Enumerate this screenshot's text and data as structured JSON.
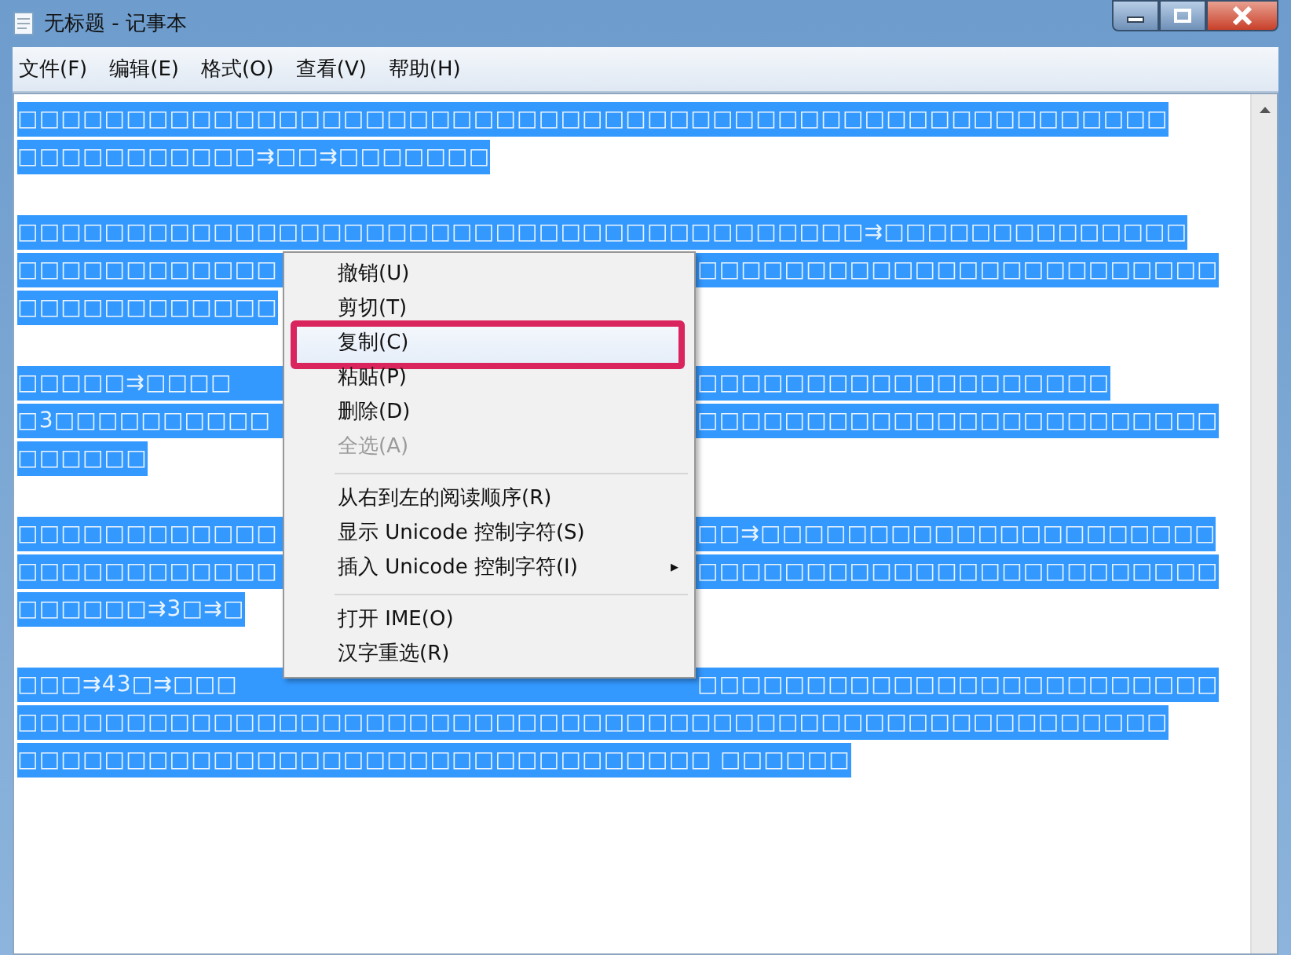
{
  "window": {
    "title": "无标题 - 记事本"
  },
  "menu_bar": [
    "文件(F)",
    "编辑(E)",
    "格式(O)",
    "查看(V)",
    "帮助(H)"
  ],
  "paragraphs": [
    {
      "lines": [
        {
          "left": "□□□□□□□□□□□□□□□□□□□□□□□□□□□□□□□□□□□□□□□□□□□□□□□□□□□□□"
        },
        {
          "left": "□□□□□□□□□□□⇉□□⇉□□□□□□□"
        }
      ]
    },
    {
      "lines": [
        {
          "left": "□□□□□□□□□□□□□□□□□□□□□□□□□□□□□□□□□□□□□□□⇉□□□□□□□□□□□□□□"
        },
        {
          "left": "□□□□□□□□□□□□",
          "right": "□□□□□□□□□□□□□□□□□□□□□□□□"
        },
        {
          "left": "□□□□□□□□□□□□"
        }
      ]
    },
    {
      "lines": [
        {
          "left": "□□□□□⇉□□□□",
          "right": "□□□□□□□□□□□□□□□□□□□"
        },
        {
          "left": "□3□□□□□□□□□□",
          "right": "□□□□□□□□□□□□□□□□□□□□□□□□"
        },
        {
          "left": "□□□□□□"
        }
      ]
    },
    {
      "lines": [
        {
          "left": "□□□□□□□□□□□□",
          "right": "□□⇉□□□□□□□□□□□□□□□□□□□□□"
        },
        {
          "left": "□□□□□□□□□□□□",
          "right": "□□□□□□□□□□□□□□□□□□□□□□□□"
        },
        {
          "left": "□□□□□□⇉3□⇉□"
        }
      ]
    },
    {
      "lines": [
        {
          "left": "□□□⇉43□⇉□□□",
          "right": "□□□□□□□□□□□□□□□□□□□□□□□□"
        },
        {
          "left": "□□□□□□□□□□□□□□□□□□□□□□□□□□□□□□□□□□□□□□□□□□□□□□□□□□□□□"
        },
        {
          "left": "□□□□□□□□□□□□□□□□□□□□□□□□□□□□□□□□ □□□□□□"
        }
      ]
    }
  ],
  "context_menu": {
    "items": [
      {
        "kind": "item",
        "label": "撤销(U)",
        "disabled": false,
        "selected": false,
        "highlighted": false
      },
      {
        "kind": "item",
        "label": "剪切(T)",
        "disabled": false,
        "selected": false,
        "highlighted": false
      },
      {
        "kind": "item",
        "label": "复制(C)",
        "disabled": false,
        "selected": true,
        "highlighted": true
      },
      {
        "kind": "item",
        "label": "粘贴(P)",
        "disabled": false,
        "selected": false,
        "highlighted": false
      },
      {
        "kind": "item",
        "label": "删除(D)",
        "disabled": false,
        "selected": false,
        "highlighted": false
      },
      {
        "kind": "item",
        "label": "全选(A)",
        "disabled": true,
        "selected": false,
        "highlighted": false
      },
      {
        "kind": "separator"
      },
      {
        "kind": "item",
        "label": "从右到左的阅读顺序(R)",
        "disabled": false,
        "selected": false,
        "highlighted": false
      },
      {
        "kind": "item",
        "label": "显示 Unicode 控制字符(S)",
        "disabled": false,
        "selected": false,
        "highlighted": false
      },
      {
        "kind": "submenu",
        "label": "插入 Unicode 控制字符(I)",
        "arrow": "▸",
        "disabled": false,
        "selected": false,
        "highlighted": false
      },
      {
        "kind": "separator"
      },
      {
        "kind": "item",
        "label": "打开 IME(O)",
        "disabled": false,
        "selected": false,
        "highlighted": false
      },
      {
        "kind": "item",
        "label": "汉字重选(R)",
        "disabled": false,
        "selected": false,
        "highlighted": false
      }
    ]
  }
}
